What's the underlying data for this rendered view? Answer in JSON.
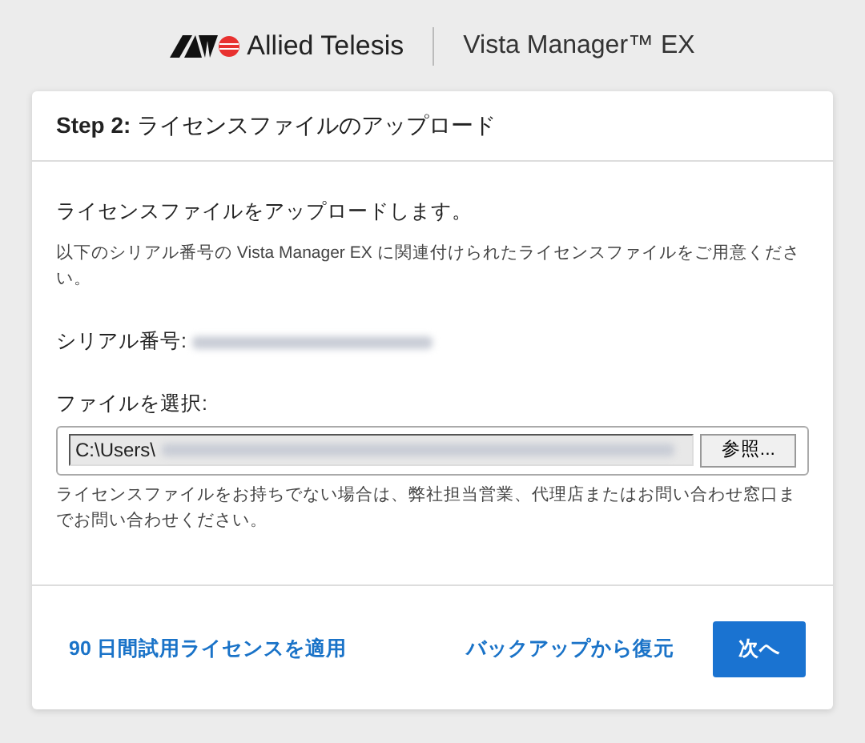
{
  "header": {
    "brand": "Allied Telesis",
    "product": "Vista Manager™ EX"
  },
  "card": {
    "title": "**Step 2:** ライセンスファイルのアップロード",
    "intro": "ライセンスファイルをアップロードします。",
    "description": "以下のシリアル番号の Vista Manager EX に関連付けられたライセンスファイルをご用意ください。",
    "serial_label": "シリアル番号:",
    "file_label": "ファイルを選択:",
    "file_value": "C:\\Users\\",
    "browse_button": "参照...",
    "help": "ライセンスファイルをお持ちでない場合は、弊社担当営業、代理店またはお問い合わせ窓口までお問い合わせください。"
  },
  "footer": {
    "trial_link": "90 日間試用ライセンスを適用",
    "restore_link": "バックアップから復元",
    "next_button": "次へ"
  }
}
